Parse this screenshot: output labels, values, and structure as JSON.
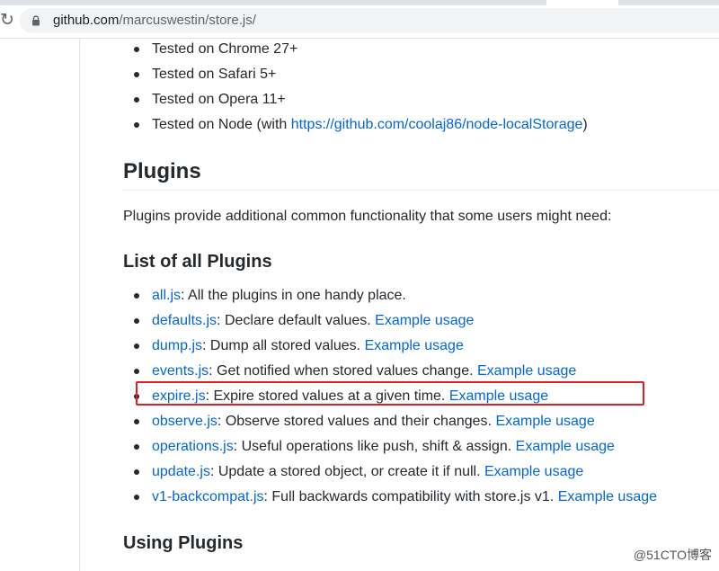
{
  "browser": {
    "reload_icon": "reload-icon",
    "lock_icon": "lock-icon",
    "url_host": "github.com",
    "url_path": "/marcuswestin/store.js/"
  },
  "tested_list": [
    {
      "text": "Tested on Chrome 27+"
    },
    {
      "text": "Tested on Safari 5+"
    },
    {
      "text": "Tested on Opera 11+"
    },
    {
      "text": "Tested on Node (with ",
      "link": "https://github.com/coolaj86/node-localStorage",
      "after": ")"
    }
  ],
  "plugins_section": {
    "heading": "Plugins",
    "intro": "Plugins provide additional common functionality that some users might need:",
    "list_heading": "List of all Plugins",
    "items": [
      {
        "name": "all.js",
        "desc": ": All the plugins in one handy place.",
        "example": ""
      },
      {
        "name": "defaults.js",
        "desc": ": Declare default values. ",
        "example": "Example usage"
      },
      {
        "name": "dump.js",
        "desc": ": Dump all stored values. ",
        "example": "Example usage"
      },
      {
        "name": "events.js",
        "desc": ": Get notified when stored values change. ",
        "example": "Example usage"
      },
      {
        "name": "expire.js",
        "desc": ": Expire stored values at a given time. ",
        "example": "Example usage"
      },
      {
        "name": "observe.js",
        "desc": ": Observe stored values and their changes. ",
        "example": "Example usage"
      },
      {
        "name": "operations.js",
        "desc": ": Useful operations like push, shift & assign. ",
        "example": "Example usage"
      },
      {
        "name": "update.js",
        "desc": ": Update a stored object, or create it if null. ",
        "example": "Example usage"
      },
      {
        "name": "v1-backcompat.js",
        "desc": ": Full backwards compatibility with store.js v1. ",
        "example": "Example usage"
      }
    ],
    "using_heading": "Using Plugins"
  },
  "watermark": "@51CTO博客",
  "colors": {
    "link": "#0366d6",
    "text": "#24292e",
    "highlight": "#e02020"
  }
}
